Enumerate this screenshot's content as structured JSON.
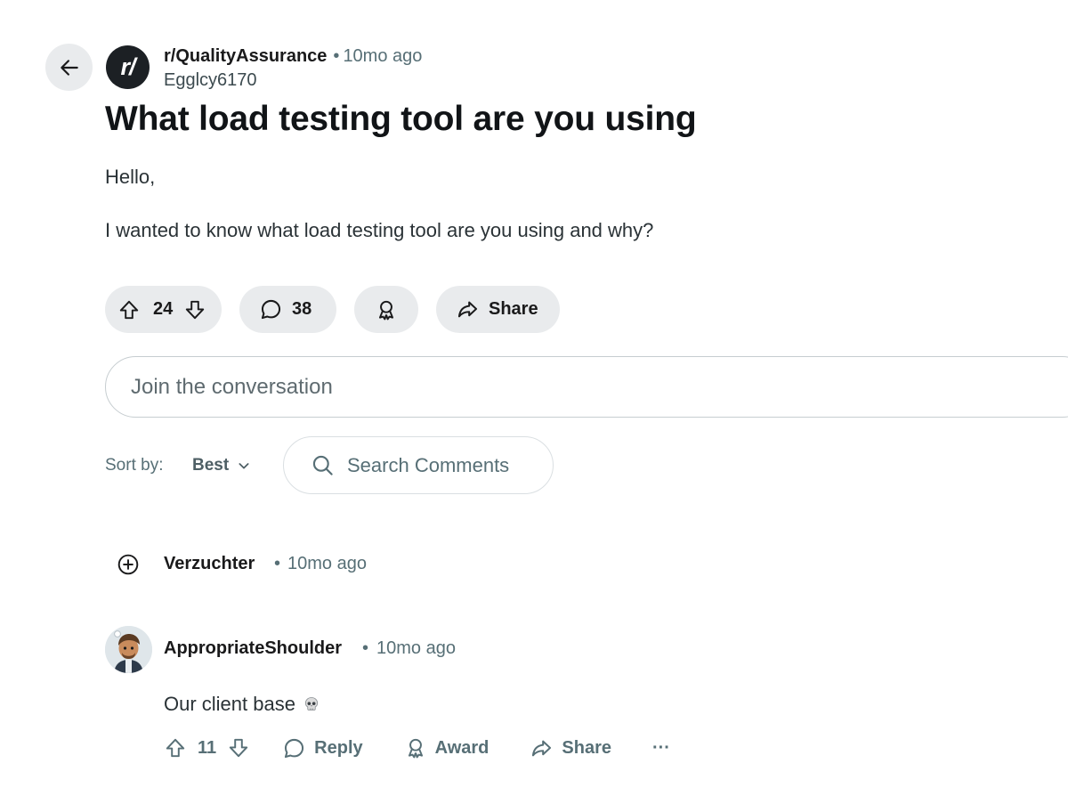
{
  "post": {
    "subreddit": "r/QualityAssurance",
    "subreddit_logo_text": "r/",
    "separator": "•",
    "age": "10mo ago",
    "author": "Egglcy6170",
    "title": "What load testing tool are you using",
    "body": [
      "Hello,",
      "I wanted to know what load testing tool are you using and why?"
    ],
    "votes": "24",
    "comments": "38",
    "share_label": "Share"
  },
  "composer": {
    "placeholder": "Join the conversation"
  },
  "sort": {
    "label": "Sort by:",
    "value": "Best"
  },
  "search": {
    "placeholder": "Search Comments"
  },
  "comments": [
    {
      "user": "Verzuchter",
      "age": "10mo ago",
      "collapsed": true
    },
    {
      "user": "AppropriateShoulder",
      "age": "10mo ago",
      "text": "Our client base",
      "emoji": "skull",
      "votes": "11",
      "reply_label": "Reply",
      "award_label": "Award",
      "share_label": "Share",
      "more_label": "···"
    }
  ],
  "icons": [
    "back-arrow-icon",
    "upvote-icon",
    "downvote-icon",
    "comment-icon",
    "award-icon",
    "share-icon",
    "chevron-down-icon",
    "search-icon",
    "expand-plus-icon",
    "more-icon",
    "skull-icon"
  ]
}
